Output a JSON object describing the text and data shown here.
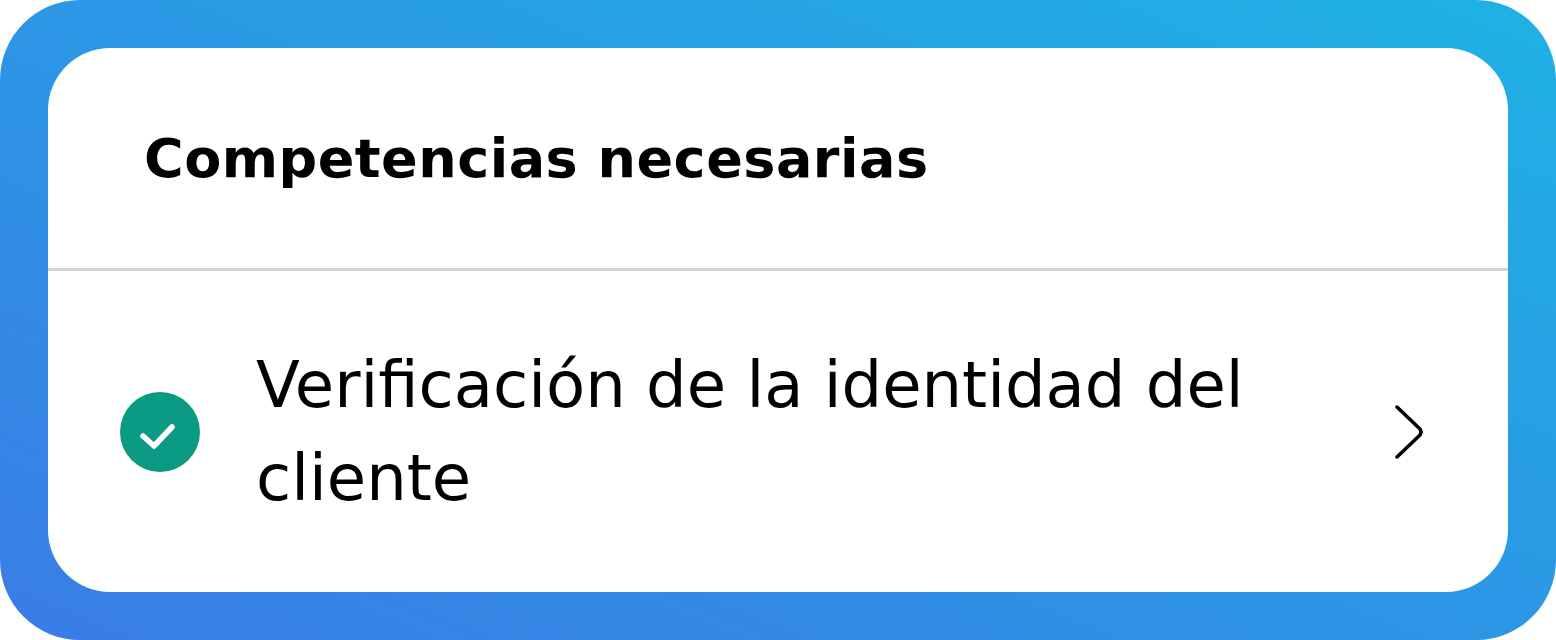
{
  "card": {
    "title": "Competencias necesarias"
  },
  "skills": [
    {
      "label": "Verificación de la identidad del cliente",
      "completed": true
    }
  ]
}
